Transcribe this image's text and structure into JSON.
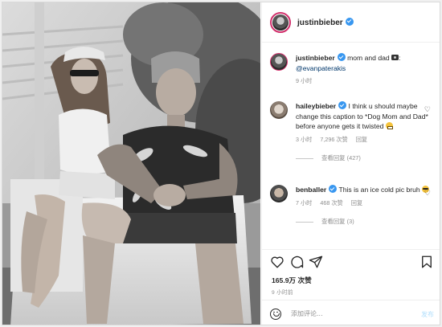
{
  "post": {
    "author": "justinbieber",
    "caption_text": "mom and dad",
    "caption_mention": "@evanpaterakis",
    "caption_time": "9 小时"
  },
  "comments": [
    {
      "user": "haileybieber",
      "text": "I think u should maybe change this caption to *Dog Mom and Dad* before anyone gets it twisted",
      "time": "3 小时",
      "likes": "7,296 次赞",
      "reply": "回复",
      "view_replies": "查看回复 (427)"
    },
    {
      "user": "benballer",
      "text": "This is an ice cold pic bruh",
      "time": "7 小时",
      "likes": "468 次赞",
      "reply": "回复",
      "view_replies": "查看回复 (3)"
    }
  ],
  "actions": {
    "like_count": "165.9万 次赞",
    "post_time": "9 小时前"
  },
  "composer": {
    "placeholder": "添加评论...",
    "post_label": "发布"
  },
  "colors": {
    "verified": "#3897f0",
    "link": "#00376b",
    "avatar_ring": "#d12f6b",
    "post_button_disabled": "#b2dffc"
  },
  "icons": [
    "verified-icon",
    "heart-icon",
    "comment-icon",
    "share-icon",
    "bookmark-icon",
    "emoji-icon",
    "camera-emoji-icon",
    "sunglasses-emoji-icon",
    "grin-emoji-icon"
  ]
}
